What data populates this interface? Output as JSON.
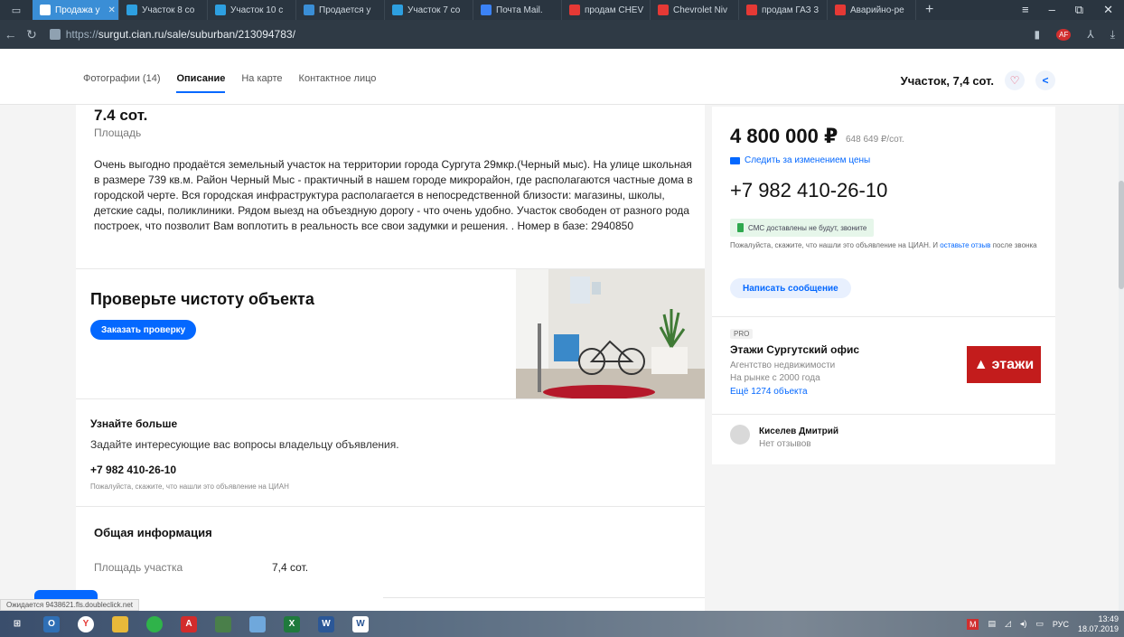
{
  "browser": {
    "tabs": [
      {
        "label": "Продажа у",
        "color": "#ffffff",
        "active": true
      },
      {
        "label": "Участок 8 со",
        "color": "#2d9fe0"
      },
      {
        "label": "Участок 10 с",
        "color": "#2d9fe0"
      },
      {
        "label": "Продается у",
        "color": "#3a8ed6"
      },
      {
        "label": "Участок 7 со",
        "color": "#2d9fe0"
      },
      {
        "label": "Почта Mail.",
        "color": "#3b82f6"
      },
      {
        "label": "продам CHEV",
        "color": "#e53935"
      },
      {
        "label": "Chevrolet Niv",
        "color": "#e53935"
      },
      {
        "label": "продам ГАЗ 3",
        "color": "#e53935"
      },
      {
        "label": "Аварийно-ре",
        "color": "#e53935"
      }
    ],
    "url_proto": "https://",
    "url_rest": "surgut.cian.ru/sale/suburban/213094783/",
    "status_text": "Ожидается 9438621.fls.doubleclick.net"
  },
  "site_nav": {
    "items": [
      "Фотографии (14)",
      "Описание",
      "На карте",
      "Контактное лицо"
    ],
    "active_index": 1,
    "header_title": "Участок, 7,4 сот."
  },
  "main": {
    "area_value": "7.4 сот.",
    "area_label": "Площадь",
    "description": "Очень выгодно продаётся земельный участок на территории города Сургута 29мкр.(Черный мыс). На улице школьная в размере 739 кв.м. Район Черный Мыс - практичный в нашем городе микрорайон, где располагаются частные дома в городской черте. Вся городская инфраструктура располагается в непосредственной близости: магазины, школы, детские сады, поликлиники. Рядом выезд на объездную дорогу - что очень удобно. Участок свободен от разного рода построек, что позволит Вам воплотить в реальность все свои задумки и решения. . Номер в базе: 2940850",
    "check_title": "Проверьте чистоту объекта",
    "check_button": "Заказать проверку",
    "learn_title": "Узнайте больше",
    "learn_sub": "Задайте интересующие вас вопросы владельцу объявления.",
    "learn_phone": "+7 982 410-26-10",
    "learn_note": "Пожалуйста, скажите, что нашли это объявление на ЦИАН",
    "info_title": "Общая информация",
    "info_rows": [
      {
        "label": "Площадь участка",
        "value": "7,4 сот."
      }
    ]
  },
  "sidebar": {
    "price": "4 800 000 ₽",
    "price_per": "648 649 ₽/сот.",
    "watch_price": "Следить за изменением цены",
    "phone": "+7 982 410-26-10",
    "sms_note": "СМС доставлены не будут, звоните",
    "mention_text": "Пожалуйста, скажите, что нашли это объявление на ЦИАН. И",
    "mention_link": "оставьте отзыв",
    "mention_tail": "после звонка",
    "message_button": "Написать сообщение",
    "pro_badge": "PRO",
    "agency_name": "Этажи Сургутский офис",
    "agency_type": "Агентство недвижимости",
    "agency_years": "На рынке с 2000 года",
    "agency_more": "Ещё 1274 объекта",
    "agency_logo": "этажи",
    "contact_name": "Киселев Дмитрий",
    "contact_reviews": "Нет отзывов"
  },
  "taskbar": {
    "lang": "РУС",
    "time": "13:49",
    "date": "18.07.2019"
  },
  "colors": {
    "accent": "#0468ff",
    "brand_red": "#c31c1c"
  }
}
